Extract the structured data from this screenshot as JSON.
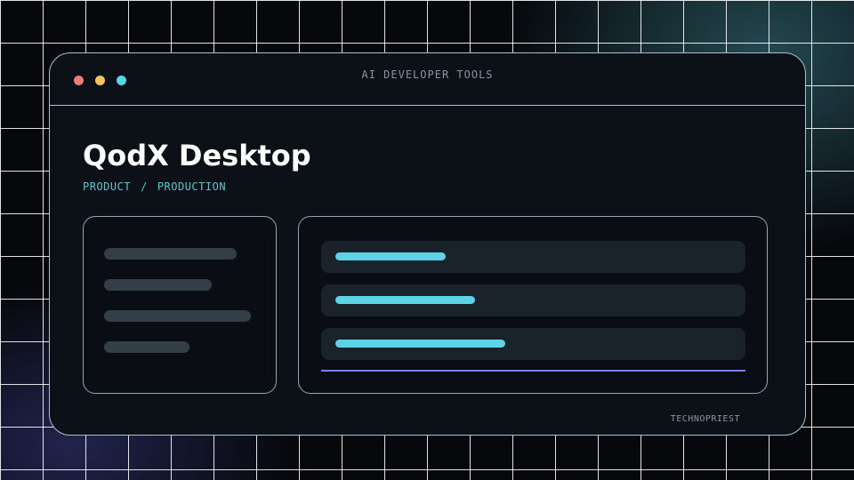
{
  "window": {
    "title": "AI DEVELOPER TOOLS",
    "controls": [
      {
        "name": "close",
        "color": "#f07a78"
      },
      {
        "name": "minimize",
        "color": "#f0c45a"
      },
      {
        "name": "zoom",
        "color": "#5fd3e6"
      }
    ]
  },
  "main": {
    "title": "QodX Desktop",
    "breadcrumb": {
      "first": "PRODUCT",
      "separator": "/",
      "second": "PRODUCTION"
    }
  },
  "left_panel": {
    "placeholder_bar_color": "#343e47"
  },
  "right_panel": {
    "rows": [
      {
        "fill_fraction": 0.26
      },
      {
        "fill_fraction": 0.33
      },
      {
        "fill_fraction": 0.4
      }
    ],
    "fill_color": "#5fd3e6",
    "divider_color": "#7b7ff0"
  },
  "footer": {
    "label": "TECHNOPRIEST"
  }
}
